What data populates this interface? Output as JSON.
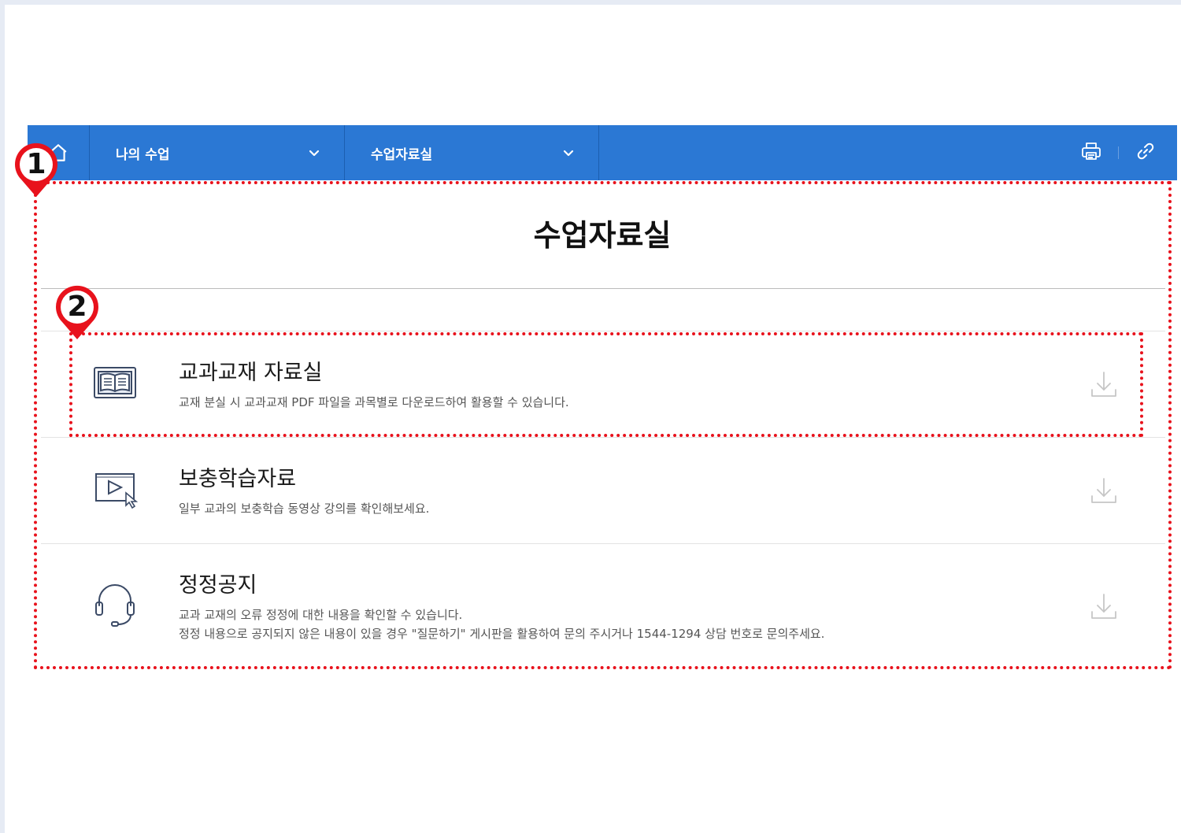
{
  "nav": {
    "home_icon": "home-icon",
    "menu1_label": "나의 수업",
    "menu2_label": "수업자료실",
    "dropdown_icon": "chevron-down-icon",
    "print_icon": "print-icon",
    "link_icon": "link-icon",
    "bar_color": "#2b78d4"
  },
  "page": {
    "title": "수업자료실"
  },
  "resources": [
    {
      "title": "교과교재 자료실",
      "desc_lines": [
        "교재 분실 시 교과교재 PDF 파일을 과목별로 다운로드하여 활용할 수 있습니다."
      ],
      "icon": "book-icon",
      "action_icon": "download-icon"
    },
    {
      "title": "보충학습자료",
      "desc_lines": [
        "일부 교과의 보충학습 동영상 강의를 확인해보세요."
      ],
      "icon": "video-play-icon",
      "action_icon": "download-icon"
    },
    {
      "title": "정정공지",
      "desc_lines": [
        "교과 교재의 오류 정정에 대한 내용을 확인할 수 있습니다.",
        "정정 내용으로 공지되지 않은 내용이 있을 경우 \"질문하기\" 게시판을 활용하여 문의 주시거나 1544-1294 상담 번호로 문의주세요."
      ],
      "icon": "headset-icon",
      "action_icon": "download-icon"
    }
  ],
  "annotations": [
    {
      "label": "1",
      "color": "#e8121c"
    },
    {
      "label": "2",
      "color": "#e8121c"
    }
  ]
}
